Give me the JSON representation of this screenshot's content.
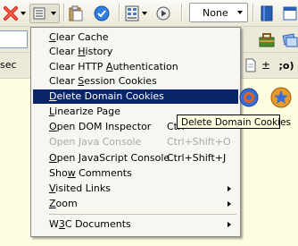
{
  "toolbar": {
    "select_value": "None"
  },
  "toolbar3": {
    "partial_label": "sec",
    "plus_minus": "±",
    "semicolon_label": ";o)"
  },
  "menu": {
    "items": [
      {
        "pre": "",
        "u": "C",
        "post": "lear Cache",
        "shortcut": "",
        "state": "normal",
        "submenu": false
      },
      {
        "pre": "Clear ",
        "u": "H",
        "post": "istory",
        "shortcut": "",
        "state": "normal",
        "submenu": false
      },
      {
        "pre": "Clear HTTP ",
        "u": "A",
        "post": "uthentication",
        "shortcut": "",
        "state": "normal",
        "submenu": false
      },
      {
        "pre": "Clear ",
        "u": "S",
        "post": "ession Cookies",
        "shortcut": "",
        "state": "normal",
        "submenu": false
      },
      {
        "pre": "",
        "u": "D",
        "post": "elete Domain Cookies",
        "shortcut": "",
        "state": "selected",
        "submenu": false
      },
      {
        "pre": "",
        "u": "L",
        "post": "inearize Page",
        "shortcut": "",
        "state": "normal",
        "submenu": false
      },
      {
        "pre": "",
        "u": "O",
        "post": "pen DOM Inspector",
        "shortcut": "Ctrl",
        "state": "normal",
        "submenu": false
      },
      {
        "pre": "Open Java Console",
        "u": "",
        "post": "",
        "shortcut": "Ctrl+Shift+O",
        "state": "disabled",
        "submenu": false
      },
      {
        "pre": "",
        "u": "O",
        "post": "pen JavaScript Console",
        "shortcut": "Ctrl+Shift+J",
        "state": "normal",
        "submenu": false
      },
      {
        "pre": "Sho",
        "u": "w",
        "post": " Comments",
        "shortcut": "",
        "state": "normal",
        "submenu": false
      },
      {
        "pre": "",
        "u": "V",
        "post": "isited Links",
        "shortcut": "",
        "state": "normal",
        "submenu": true
      },
      {
        "pre": "",
        "u": "Z",
        "post": "oom",
        "shortcut": "",
        "state": "normal",
        "submenu": true
      },
      {
        "pre": "W",
        "u": "3",
        "post": "C Documents",
        "shortcut": "",
        "state": "normal",
        "submenu": true
      }
    ]
  },
  "tooltip": {
    "text": "Delete Domain Cookies"
  },
  "colors": {
    "menu_selection": "#0a246a",
    "tooltip_bg": "#ffffe1",
    "toolbar_bg": "#ece9d8"
  }
}
